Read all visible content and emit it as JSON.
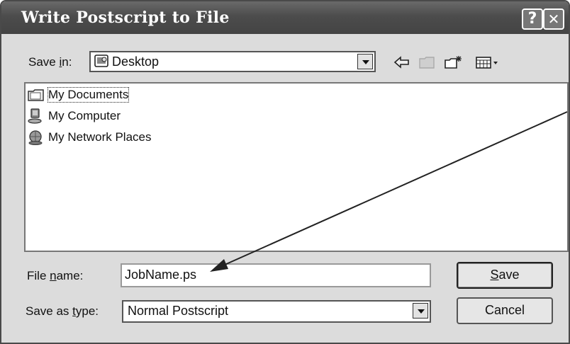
{
  "window": {
    "title": "Write Postscript to File",
    "help_glyph": "?",
    "close_glyph": "✕"
  },
  "save_in": {
    "label_pre": "Save ",
    "label_accel": "i",
    "label_post": "n:",
    "value": "Desktop",
    "icon": "desktop-icon"
  },
  "toolbar": {
    "back_icon": "back-arrow-icon",
    "up_icon": "up-folder-icon",
    "new_folder_icon": "new-folder-icon",
    "view_icon": "view-menu-icon"
  },
  "files": [
    {
      "label": "My Documents",
      "icon": "my-documents-icon",
      "focused": true
    },
    {
      "label": "My Computer",
      "icon": "my-computer-icon",
      "focused": false
    },
    {
      "label": "My Network Places",
      "icon": "network-places-icon",
      "focused": false
    }
  ],
  "file_name": {
    "label_pre": "File ",
    "label_accel": "n",
    "label_post": "ame:",
    "value": "JobName.ps"
  },
  "save_as_type": {
    "label_pre": "Save as ",
    "label_accel": "t",
    "label_post": "ype:",
    "value": "Normal Postscript"
  },
  "buttons": {
    "save_accel": "S",
    "save_rest": "ave",
    "cancel": "Cancel"
  },
  "colors": {
    "dialog_bg": "#dcdcdc",
    "titlebar": "#4c4c4c",
    "annotation_arrow": "#222222"
  }
}
